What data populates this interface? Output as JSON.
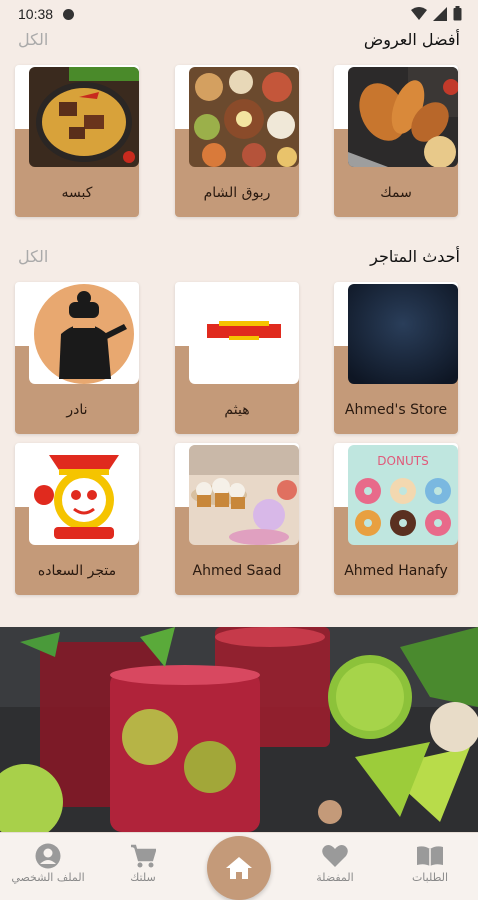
{
  "status_bar": {
    "time": "10:38"
  },
  "offers": {
    "title": "أفضل العروض",
    "see_all": "الكل",
    "items": [
      {
        "label": "سمك"
      },
      {
        "label": "ربوق الشام"
      },
      {
        "label": "كبسه"
      }
    ]
  },
  "stores": {
    "title": "أحدث المتاجر",
    "see_all": "الكل",
    "items": [
      {
        "label": "Ahmed's Store"
      },
      {
        "label": "هيثم"
      },
      {
        "label": "نادر"
      },
      {
        "label": "Ahmed Hanafy"
      },
      {
        "label": "Ahmed Saad"
      },
      {
        "label": "متجر السعاده"
      }
    ],
    "donut_sign": "DONUTS"
  },
  "bottom_nav": {
    "orders": "الطلبات",
    "favorites": "المفضلة",
    "home_icon": "home-icon",
    "cart": "سلتك",
    "profile": "الملف الشخصي"
  },
  "colors": {
    "accent": "#c49a79",
    "background": "#f5ece6"
  }
}
